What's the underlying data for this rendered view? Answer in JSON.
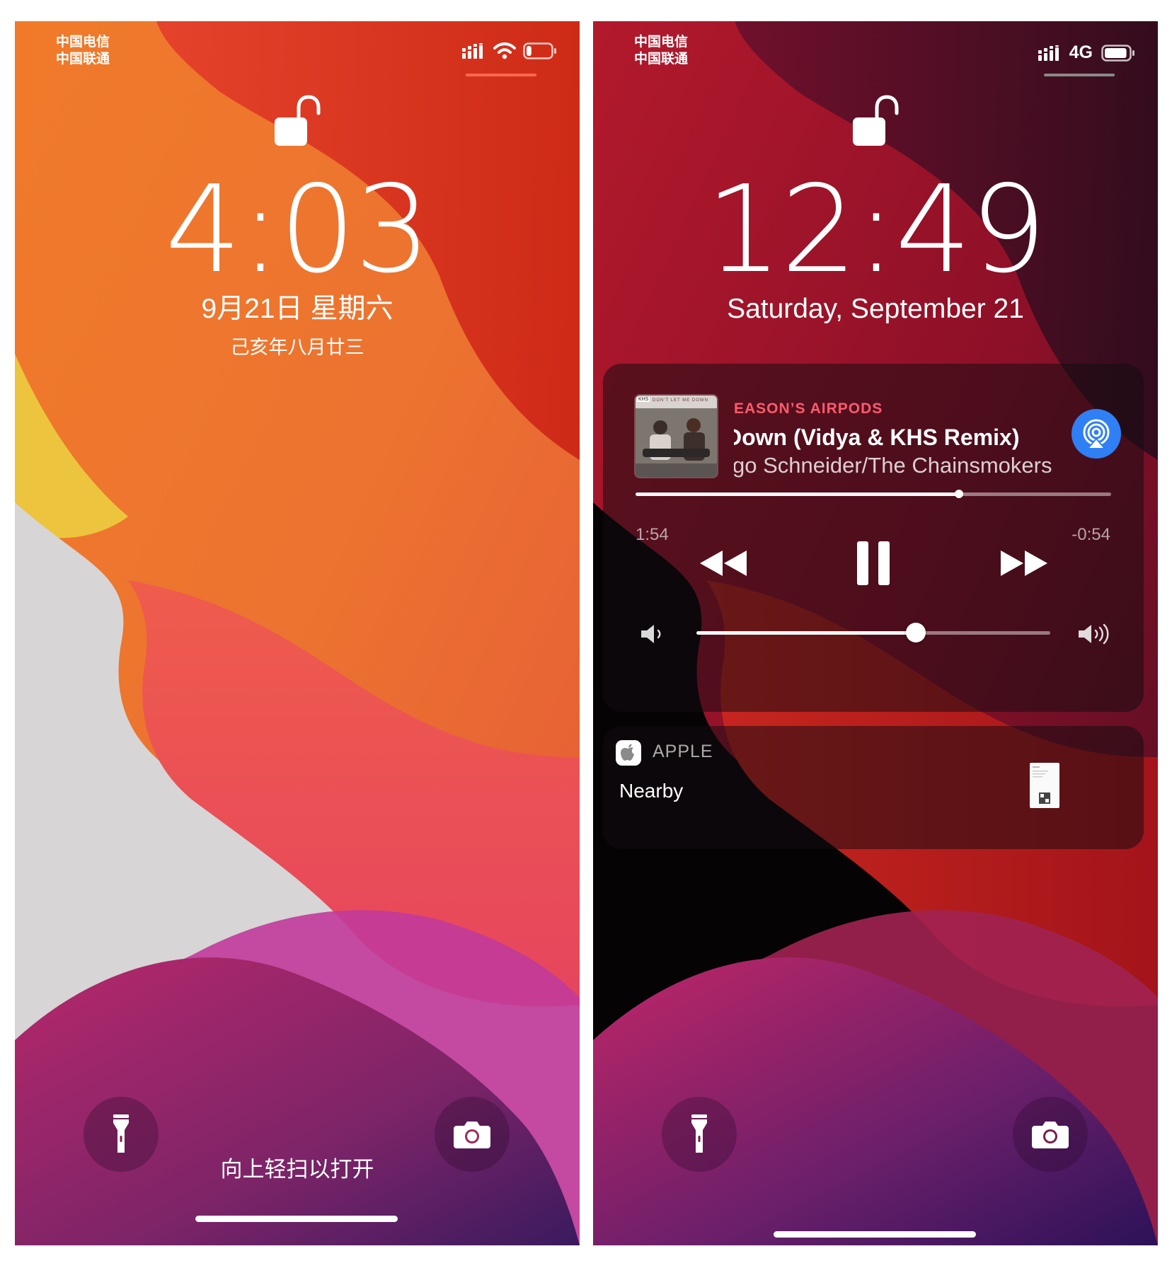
{
  "left_screen": {
    "carrier_line1": "中国电信",
    "carrier_line2": "中国联通",
    "time": "4:03",
    "date": "9月21日 星期六",
    "lunar_date": "己亥年八月廿三",
    "swipe_hint": "向上轻扫以打开",
    "battery_level": 0.2,
    "status_underline_color": "#ff6a4d",
    "icons": [
      "cellular-signal-icon",
      "wifi-icon",
      "battery-icon",
      "lock-open-icon",
      "flashlight-icon",
      "camera-icon"
    ]
  },
  "right_screen": {
    "carrier_line1": "中国电信",
    "carrier_line2": "中国联通",
    "network_type": "4G",
    "time": "12:49",
    "date": "Saturday, September 21",
    "battery_level": 0.9,
    "status_underline_color": "#8a8a8a",
    "now_playing": {
      "device": "EASON’S AIRPODS",
      "title": "Down (Vidya & KHS Remix)",
      "artist": "go Schneider/The Chainsmokers",
      "elapsed": "1:54",
      "remaining": "-0:54",
      "progress": 0.68,
      "volume": 0.62,
      "album_art_text": "DON'T LET ME DOWN",
      "album_art_badge": "KHS",
      "accent_color": "#ff5a6e",
      "airplay_color": "#2f7ff5"
    },
    "notification": {
      "app": "APPLE",
      "body": "Nearby"
    },
    "icons": [
      "cellular-signal-icon",
      "battery-icon",
      "lock-open-icon",
      "album-art",
      "airplay-icon",
      "rewind-icon",
      "pause-icon",
      "fast-forward-icon",
      "volume-low-icon",
      "volume-high-icon",
      "apple-logo-icon",
      "flashlight-icon",
      "camera-icon"
    ]
  }
}
